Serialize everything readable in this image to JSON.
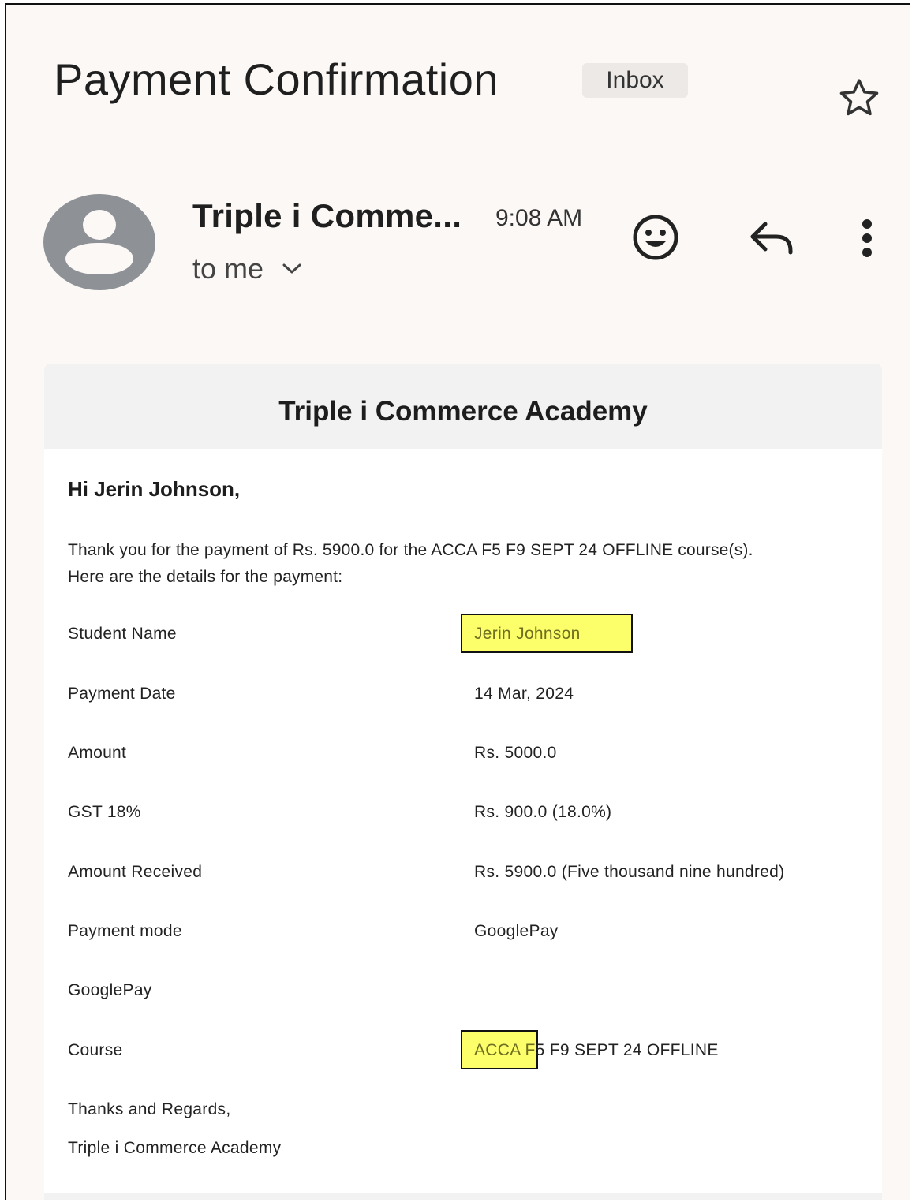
{
  "email": {
    "subject": "Payment Confirmation",
    "label": "Inbox",
    "sender": "Triple i Comme...",
    "time": "9:08 AM",
    "recipient": "to me",
    "icons": [
      "star-icon",
      "avatar-icon",
      "chevron-down-icon",
      "emoji-icon",
      "reply-icon",
      "more-vert-icon"
    ]
  },
  "body": {
    "header": "Triple i Commerce Academy",
    "greeting": "Hi Jerin Johnson,",
    "intro_line1": "Thank you for the payment of Rs. 5900.0 for the ACCA F5 F9 SEPT 24 OFFLINE course(s).",
    "intro_line2": "Here are the details for the payment:",
    "details": [
      {
        "label": "Student Name",
        "value": "Jerin Johnson"
      },
      {
        "label": "Payment Date",
        "value": "14 Mar, 2024"
      },
      {
        "label": "Amount",
        "value": "Rs. 5000.0"
      },
      {
        "label": "GST 18%",
        "value": "Rs. 900.0 (18.0%)"
      },
      {
        "label": "Amount Received",
        "value": "Rs. 5900.0 (Five thousand nine hundred)"
      },
      {
        "label": "Payment mode",
        "value": "GooglePay"
      },
      {
        "label": "GooglePay",
        "value": ""
      },
      {
        "label": "Course",
        "value_highlight": "ACCA F",
        "value_rest": "5 F9 SEPT 24 OFFLINE"
      }
    ],
    "signoff": "Thanks and Regards,",
    "signature": "Triple i Commerce Academy"
  },
  "colors": {
    "background": "#fbf8f5",
    "highlight": "#fcff6a",
    "avatar": "#8e9297"
  }
}
